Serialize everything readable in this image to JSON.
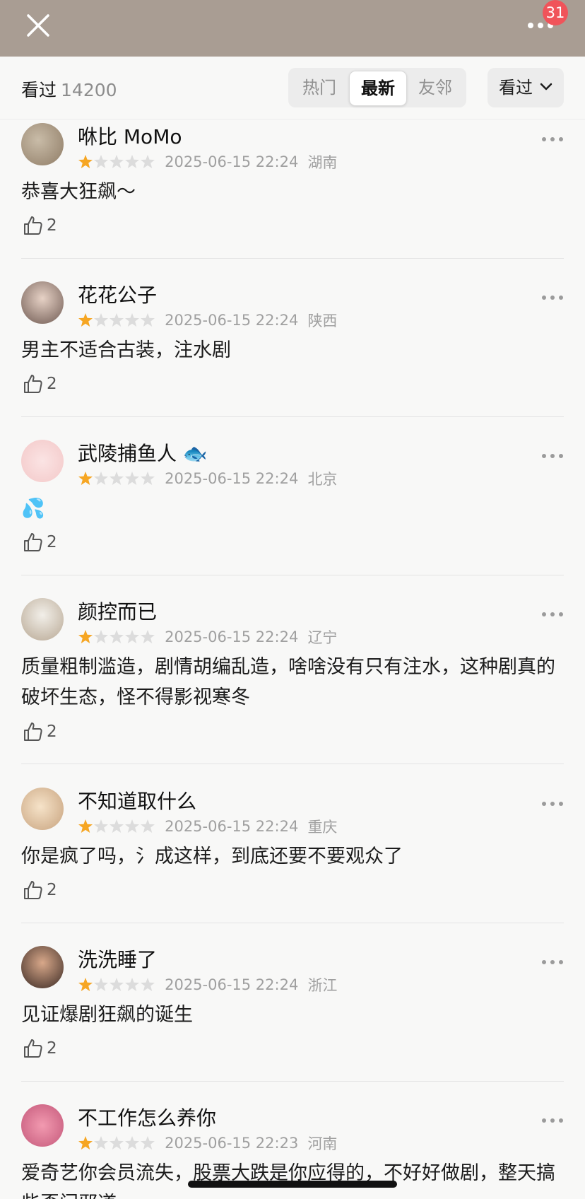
{
  "header": {
    "notification_count": "31",
    "accent": "#a99d93",
    "badge_color": "#f0545a"
  },
  "filter": {
    "title": "看过",
    "count": "14200",
    "tabs": [
      "热门",
      "最新",
      "友邻"
    ],
    "active_tab": "最新",
    "sort_label": "看过"
  },
  "reviews": [
    {
      "user": "咻比 MoMo",
      "rating": 1,
      "time": "2025-06-15 22:24",
      "location": "湖南",
      "text": "恭喜大狂飙～",
      "likes": "2"
    },
    {
      "user": "花花公子",
      "rating": 1,
      "time": "2025-06-15 22:24",
      "location": "陕西",
      "text": "男主不适合古装，注水剧",
      "likes": "2"
    },
    {
      "user": "武陵捕鱼人 🐟",
      "rating": 1,
      "time": "2025-06-15 22:24",
      "location": "北京",
      "text": "💦",
      "likes": "2"
    },
    {
      "user": "颜控而已",
      "rating": 1,
      "time": "2025-06-15 22:24",
      "location": "辽宁",
      "text": "质量粗制滥造，剧情胡编乱造，啥啥没有只有注水，这种剧真的破坏生态，怪不得影视寒冬",
      "likes": "2"
    },
    {
      "user": "不知道取什么",
      "rating": 1,
      "time": "2025-06-15 22:24",
      "location": "重庆",
      "text": "你是疯了吗，氵成这样，到底还要不要观众了",
      "likes": "2"
    },
    {
      "user": "洗洗睡了",
      "rating": 1,
      "time": "2025-06-15 22:24",
      "location": "浙江",
      "text": "见证爆剧狂飙的诞生",
      "likes": "2"
    },
    {
      "user": "不工作怎么养你",
      "rating": 1,
      "time": "2025-06-15 22:23",
      "location": "河南",
      "text": "爱奇艺你会员流失，股票大跌是你应得的，不好好做剧，整天搞些歪门邪道",
      "likes": ""
    }
  ]
}
